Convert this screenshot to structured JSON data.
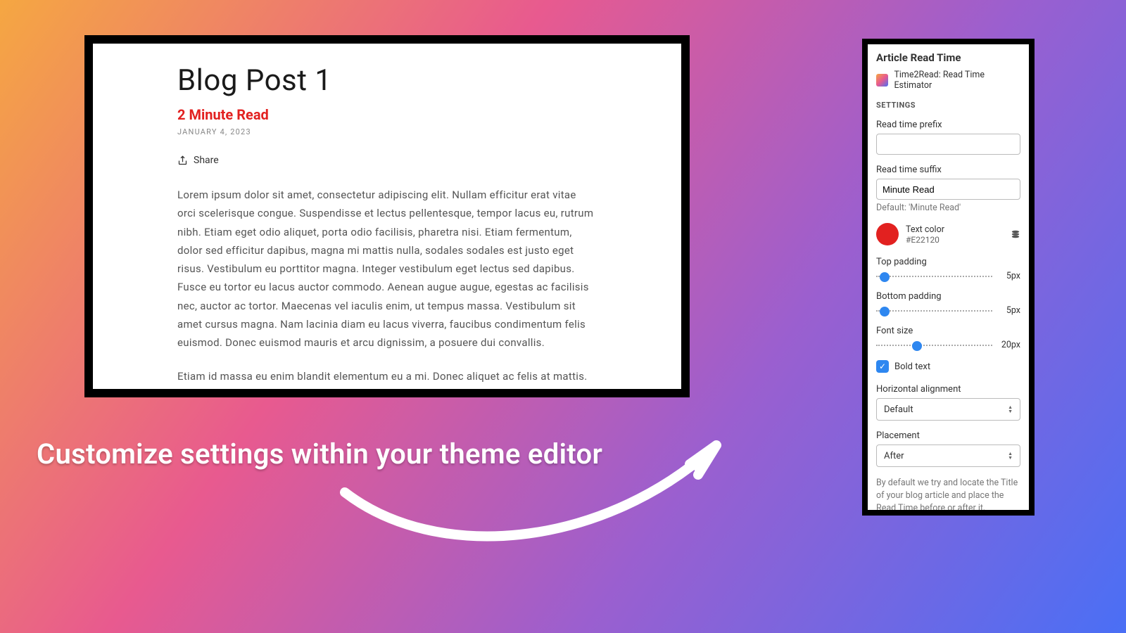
{
  "caption": "Customize settings within your theme editor",
  "blog": {
    "title": "Blog Post 1",
    "read_time": "2 Minute Read",
    "date": "JANUARY 4, 2023",
    "share_label": "Share",
    "para1": "Lorem ipsum dolor sit amet, consectetur adipiscing elit. Nullam efficitur erat vitae orci scelerisque congue. Suspendisse et lectus pellentesque, tempor lacus eu, rutrum nibh. Etiam eget odio aliquet, porta odio facilisis, pharetra nisi. Etiam fermentum, dolor sed efficitur dapibus, magna mi mattis nulla, sodales sodales est justo eget risus. Vestibulum eu porttitor magna. Integer vestibulum eget lectus sed dapibus. Fusce eu tortor eu lacus auctor commodo. Aenean augue augue, egestas ac facilisis nec, auctor ac tortor. Maecenas vel iaculis enim, ut tempus massa. Vestibulum sit amet cursus magna. Nam lacinia diam eu lacus viverra, faucibus condimentum felis euismod. Donec euismod mauris et arcu dignissim, a posuere dui convallis.",
    "para2": "Etiam id massa eu enim blandit elementum eu a mi. Donec aliquet ac felis at mattis. Fusce blandit eget elit sit amet ullamcorper. Aliquam et porttitor justo. Donec eu dictum risus. Phasellus luctus nisl fringilla ultrices dictum. Nunc rhoncus magna id erat fringilla venenatis. Praesent quis ligula dictum massa tristique gravida quis dignissim eros. Fusce dictum arcu eu lacus tristique rhoncus. Nunc lacus"
  },
  "settings": {
    "panel_title": "Article Read Time",
    "app_name": "Time2Read: Read Time Estimator",
    "section_label": "SETTINGS",
    "prefix_label": "Read time prefix",
    "prefix_value": "",
    "suffix_label": "Read time suffix",
    "suffix_value": "Minute Read",
    "suffix_helper": "Default: 'Minute Read'",
    "text_color_label": "Text color",
    "text_color_hex": "#E22120",
    "top_padding_label": "Top padding",
    "top_padding_value": "5px",
    "bottom_padding_label": "Bottom padding",
    "bottom_padding_value": "5px",
    "font_size_label": "Font size",
    "font_size_value": "20px",
    "bold_label": "Bold text",
    "h_align_label": "Horizontal alignment",
    "h_align_value": "Default",
    "placement_label": "Placement",
    "placement_value": "After",
    "footer": "By default we try and locate the Title of your blog article and place the Read Time before or after it, depending on your placement selection here."
  }
}
